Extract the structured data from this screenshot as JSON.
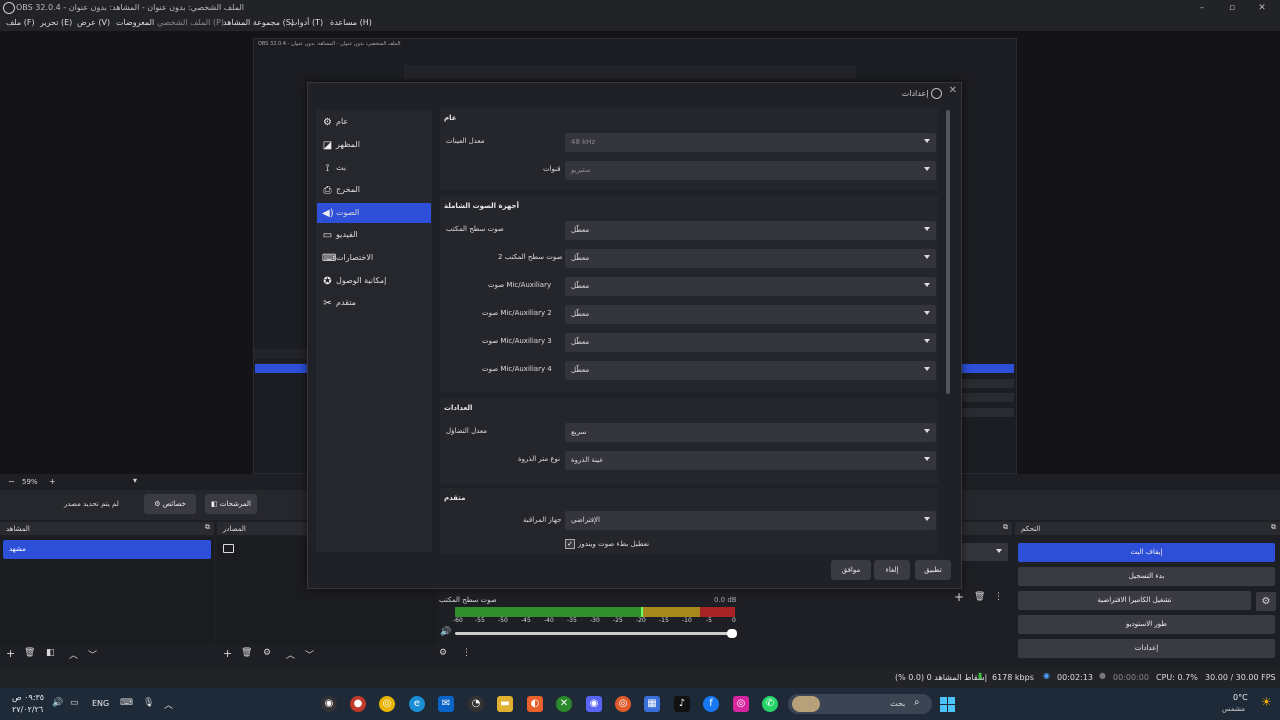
{
  "app_title": "OBS 32.0.4 - الملف الشخصي: بدون عنوان - المشاهد: بدون عنوان",
  "menu": [
    "ملف (F)",
    "تحرير (E)",
    "عرض (V)",
    "المعروضات",
    "الملف الشخصي (P)",
    "مجموعة المشاهد (S)",
    "أدوات (T)",
    "مساعدة (H)"
  ],
  "dialog": {
    "title": "إعدادات",
    "nav": [
      "عام",
      "المظهر",
      "بث",
      "المخرج",
      "الصوت",
      "الفيديو",
      "الاختصارات",
      "إمكانية الوصول",
      "متقدم"
    ],
    "selected_nav": "الصوت",
    "groups": {
      "general": {
        "title": "عام",
        "sample_rate_label": "معدل العينات",
        "sample_rate": "48 kHz",
        "channels_label": "قنوات",
        "channels": "ستيريو"
      },
      "devices": {
        "title": "أجهزة الصوت الشاملة",
        "rows": [
          {
            "label": "صوت سطح المكتب",
            "value": "معطّل"
          },
          {
            "label": "صوت سطح المكتب 2",
            "value": "معطّل"
          },
          {
            "label": "صوت Mic/Auxiliary",
            "value": "معطّل"
          },
          {
            "label": "صوت Mic/Auxiliary 2",
            "value": "معطّل"
          },
          {
            "label": "صوت Mic/Auxiliary 3",
            "value": "معطّل"
          },
          {
            "label": "صوت Mic/Auxiliary 4",
            "value": "معطّل"
          }
        ]
      },
      "meters": {
        "title": "العدادات",
        "decay_label": "معدل التضاؤل",
        "decay": "سريع",
        "peak_label": "نوع متر الذروة",
        "peak": "عينة الذروة"
      },
      "advanced": {
        "title": "متقدم",
        "monitor_label": "جهاز المراقبة",
        "monitor": "الإفتراضي",
        "ducking_label": "تعطيل بطء صوت ويندوز",
        "ducking_checked": true
      }
    },
    "buttons": {
      "ok": "موافق",
      "cancel": "إلغاء",
      "apply": "تطبيق"
    }
  },
  "zoom": "59%",
  "scene_toolbar": {
    "no_source": "لم يتم تحديد مصدر",
    "properties": "خصائص",
    "filters": "المرشحات"
  },
  "docks": {
    "scenes": "المشاهد",
    "sources": "المصادر",
    "controls": "التحكم"
  },
  "scene_item": "مشهد",
  "mixer": {
    "name": "صوت سطح المكتب",
    "db": "0.0 dB",
    "ticks": [
      "-60",
      "-55",
      "-50",
      "-45",
      "-40",
      "-35",
      "-30",
      "-25",
      "-20",
      "-15",
      "-10",
      "-5",
      "0"
    ]
  },
  "controls": [
    "إيقاف البث",
    "بدء التسجيل",
    "تشغيل الكاميرا الافتراضية",
    "طور الاستوديو",
    "إعدادات"
  ],
  "status": {
    "dropped": "إسقاط المشاهد 0 (0.0 %)",
    "kbps": "6178 kbps",
    "stream_time": "00:02:13",
    "rec_time": "00:00:00",
    "cpu": "CPU: 0.7%",
    "fps": "30.00 / 30.00 FPS"
  },
  "taskbar": {
    "weather_temp": "0°C",
    "weather_desc": "مشمس",
    "search": "بحث",
    "lang": "ENG",
    "time": "٠٩:٣٥ ص",
    "date": "٢٧/٠٢/٢٦"
  },
  "colors": {
    "accent": "#2e4fd8",
    "live": "#4ea1ff",
    "meter_green": "#2f8f2a",
    "meter_yellow": "#a68a1e",
    "meter_red": "#a82323"
  }
}
